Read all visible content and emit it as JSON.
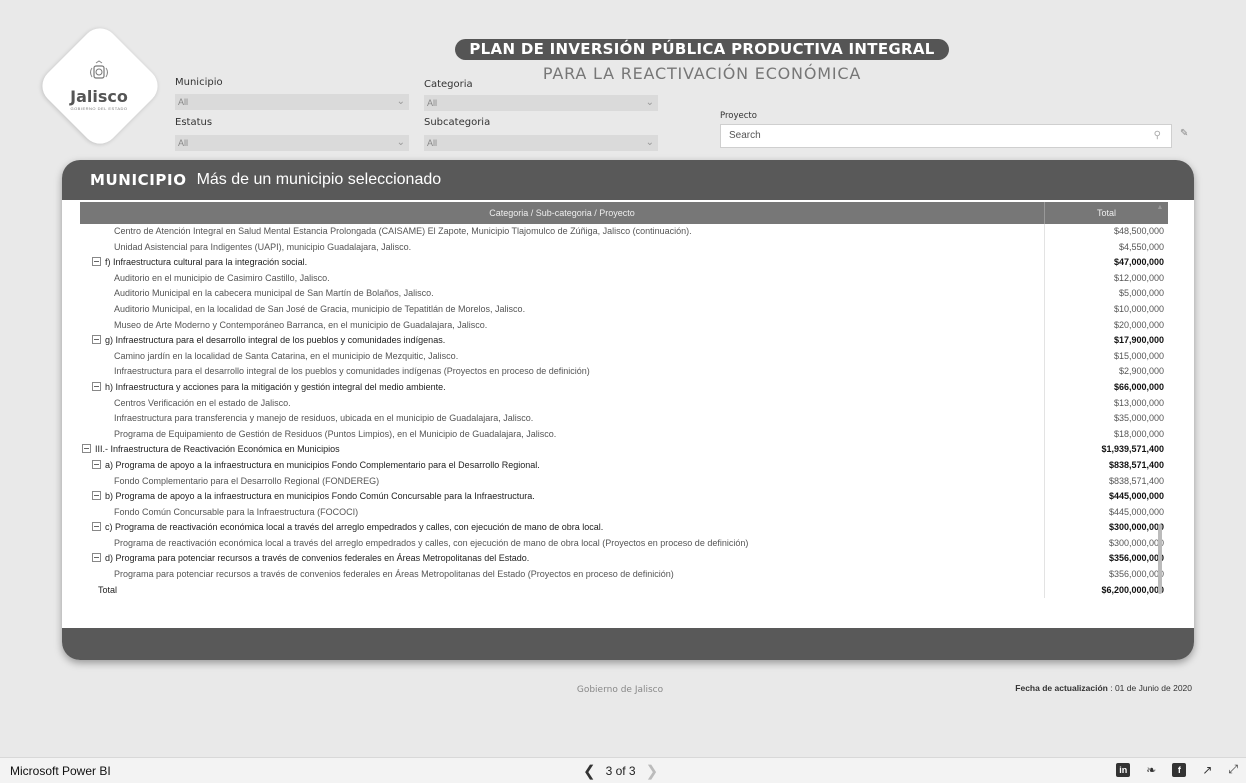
{
  "logo": {
    "name": "Jalisco",
    "sub": "GOBIERNO DEL ESTADO"
  },
  "title": "PLAN DE INVERSIÓN PÚBLICA PRODUCTIVA INTEGRAL",
  "subtitle": "PARA LA REACTIVACIÓN ECONÓMICA",
  "filters": {
    "municipio": {
      "label": "Municipio",
      "value": "All"
    },
    "estatus": {
      "label": "Estatus",
      "value": "All"
    },
    "categoria": {
      "label": "Categoria",
      "value": "All"
    },
    "subcategoria": {
      "label": "Subcategoria",
      "value": "All"
    },
    "proyecto": {
      "label": "Proyecto",
      "placeholder": "Search"
    }
  },
  "panel": {
    "key": "MUNICIPIO",
    "value": "Más de un municipio seleccionado"
  },
  "table": {
    "col1": "Categoria / Sub-categoria / Proyecto",
    "col2": "Total",
    "rows": [
      {
        "t": "Centro de Atención Integral en Salud Mental Estancia Prolongada (CAISAME) El Zapote, Municipio Tlajomulco de Zúñiga, Jalisco (continuación).",
        "v": "$48,500,000",
        "k": "p"
      },
      {
        "t": "Unidad Asistencial para Indigentes (UAPI), municipio Guadalajara, Jalisco.",
        "v": "$4,550,000",
        "k": "p"
      },
      {
        "t": "f) Infraestructura cultural para la integración social.",
        "v": "$47,000,000",
        "k": "s"
      },
      {
        "t": "Auditorio en el municipio de Casimiro Castillo, Jalisco.",
        "v": "$12,000,000",
        "k": "p"
      },
      {
        "t": "Auditorio Municipal en la cabecera municipal de San Martín de Bolaños, Jalisco.",
        "v": "$5,000,000",
        "k": "p"
      },
      {
        "t": "Auditorio Municipal, en la localidad de San José de Gracia, municipio de Tepatitlán de Morelos, Jalisco.",
        "v": "$10,000,000",
        "k": "p"
      },
      {
        "t": "Museo de Arte Moderno y Contemporáneo Barranca, en el municipio de Guadalajara, Jalisco.",
        "v": "$20,000,000",
        "k": "p"
      },
      {
        "t": "g) Infraestructura para el desarrollo integral de los pueblos y comunidades indígenas.",
        "v": "$17,900,000",
        "k": "s"
      },
      {
        "t": "Camino jardín en la localidad de Santa Catarina, en el municipio de Mezquitic, Jalisco.",
        "v": "$15,000,000",
        "k": "p"
      },
      {
        "t": "Infraestructura para el desarrollo integral de los pueblos y comunidades indígenas (Proyectos en proceso de definición)",
        "v": "$2,900,000",
        "k": "p"
      },
      {
        "t": "h) Infraestructura y acciones para la mitigación y gestión integral del medio ambiente.",
        "v": "$66,000,000",
        "k": "s"
      },
      {
        "t": "Centros Verificación en el estado de Jalisco.",
        "v": "$13,000,000",
        "k": "p"
      },
      {
        "t": "Infraestructura para transferencia y manejo de residuos, ubicada en el municipio de Guadalajara, Jalisco.",
        "v": "$35,000,000",
        "k": "p"
      },
      {
        "t": "Programa de Equipamiento de Gestión de Residuos (Puntos Limpios), en el Municipio de Guadalajara, Jalisco.",
        "v": "$18,000,000",
        "k": "p"
      },
      {
        "t": "III.- Infraestructura de Reactivación Económica en Municipios",
        "v": "$1,939,571,400",
        "k": "c"
      },
      {
        "t": "a) Programa de apoyo a la infraestructura en municipios Fondo Complementario para el Desarrollo Regional.",
        "v": "$838,571,400",
        "k": "s"
      },
      {
        "t": "Fondo Complementario para el Desarrollo Regional (FONDEREG)",
        "v": "$838,571,400",
        "k": "p"
      },
      {
        "t": "b) Programa de apoyo a la infraestructura en municipios Fondo Común Concursable para la Infraestructura.",
        "v": "$445,000,000",
        "k": "s"
      },
      {
        "t": "Fondo Común Concursable para la Infraestructura (FOCOCI)",
        "v": "$445,000,000",
        "k": "p"
      },
      {
        "t": "c) Programa de reactivación económica local a través del arreglo empedrados y calles, con ejecución de mano de obra local.",
        "v": "$300,000,000",
        "k": "s"
      },
      {
        "t": "Programa de reactivación económica local a través del arreglo empedrados y calles, con ejecución de mano de obra local (Proyectos en proceso de definición)",
        "v": "$300,000,000",
        "k": "p"
      },
      {
        "t": "d) Programa para potenciar recursos a través de convenios federales en Áreas Metropolitanas del Estado.",
        "v": "$356,000,000",
        "k": "s"
      },
      {
        "t": "Programa para potenciar recursos a través de convenios federales en Áreas Metropolitanas del Estado (Proyectos en proceso de definición)",
        "v": "$356,000,000",
        "k": "p"
      },
      {
        "t": "Total",
        "v": "$6,200,000,000",
        "k": "t"
      }
    ]
  },
  "footer": {
    "center": "Gobierno de Jalisco",
    "updated_label": "Fecha de actualización",
    "updated_value": " : 01 de Junio de 2020"
  },
  "bottombar": {
    "brand": "Microsoft Power BI",
    "page": "3 of 3",
    "icons": [
      "linkedin-icon",
      "twitter-icon",
      "facebook-icon",
      "share-icon",
      "fullscreen-icon"
    ]
  }
}
